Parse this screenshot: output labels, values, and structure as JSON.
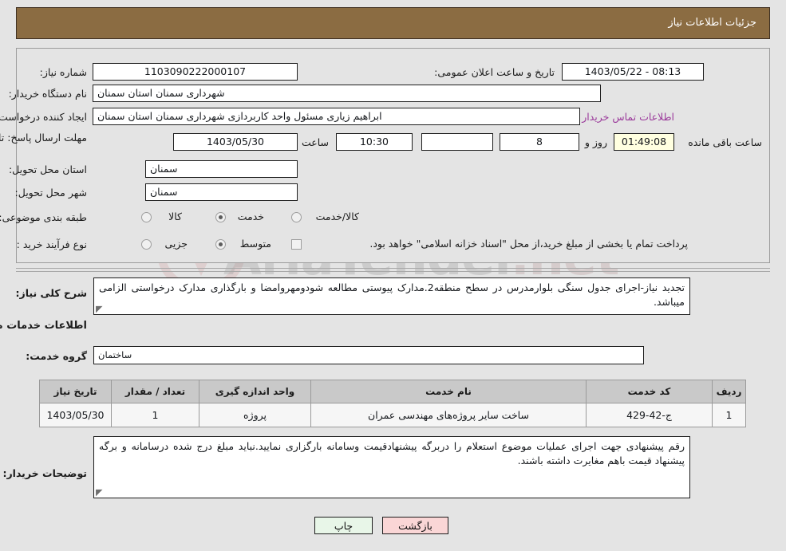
{
  "header": {
    "title": "جزئیات اطلاعات نیاز"
  },
  "watermark": {
    "text": "AriaTender",
    "suffix": ".net"
  },
  "form": {
    "need_number": {
      "label": "شماره نیاز:",
      "value": "1103090222000107"
    },
    "announce_datetime": {
      "label": "تاریخ و ساعت اعلان عمومی:",
      "value": "1403/05/22 - 08:13"
    },
    "buyer_org": {
      "label": "نام دستگاه خریدار:",
      "value": "شهرداری سمنان استان سمنان"
    },
    "requester": {
      "label": "ایجاد کننده درخواست:",
      "value": "ابراهیم زیاری مسئول واحد کاربردازی شهرداری سمنان استان سمنان"
    },
    "buyer_contact_link": "اطلاعات تماس خریدار",
    "deadline": {
      "label": "مهلت ارسال پاسخ: تا تاریخ:",
      "date": "1403/05/30",
      "hour_label": "ساعت",
      "time": "10:30",
      "remaining_blank": "",
      "days": "8",
      "days_label": "روز و",
      "countdown": "01:49:08",
      "countdown_label": "ساعت باقی مانده"
    },
    "delivery_province": {
      "label": "استان محل تحویل:",
      "value": "سمنان"
    },
    "delivery_city": {
      "label": "شهر محل تحویل:",
      "value": "سمنان"
    },
    "category": {
      "label": "طبقه بندی موضوعی:",
      "options": [
        "کالا",
        "خدمت",
        "کالا/خدمت"
      ],
      "selected": "خدمت"
    },
    "purchase_type": {
      "label": "نوع فرآیند خرید :",
      "options": [
        "جزیی",
        "متوسط"
      ],
      "selected": "متوسط",
      "checkbox_label": "پرداخت تمام یا بخشی از مبلغ خرید،از محل \"اسناد خزانه اسلامی\" خواهد بود.",
      "checkbox_checked": false
    }
  },
  "description": {
    "label": "شرح کلی نیاز:",
    "value": "تجدید نیاز-اجرای جدول سنگی بلوارمدرس در سطح منطقه2.مدارک پیوستی مطالعه شودومهروامضا و بارگذاری مدارک درخواستی الزامی میباشد."
  },
  "services_section": {
    "heading": "اطلاعات خدمات مورد نیاز",
    "service_group": {
      "label": "گروه خدمت:",
      "value": "ساختمان"
    }
  },
  "table": {
    "columns": [
      "ردیف",
      "کد خدمت",
      "نام خدمت",
      "واحد اندازه گیری",
      "تعداد / مقدار",
      "تاریخ نیاز"
    ],
    "rows": [
      {
        "row": "1",
        "code": "ج-42-429",
        "name": "ساخت سایر پروژه‌های مهندسی عمران",
        "unit": "پروژه",
        "qty": "1",
        "need_date": "1403/05/30"
      }
    ]
  },
  "buyer_notes": {
    "label": "توضیحات خریدار:",
    "value": "رقم پیشنهادی جهت اجرای عملیات موضوع استعلام را دربرگه پیشنهادقیمت وسامانه بارگزاری نمایید.نباید مبلغ درج شده درسامانه و برگه پیشنهاد قیمت باهم مغایرت داشته باشند."
  },
  "buttons": {
    "print": "چاپ",
    "back": "بازگشت"
  }
}
